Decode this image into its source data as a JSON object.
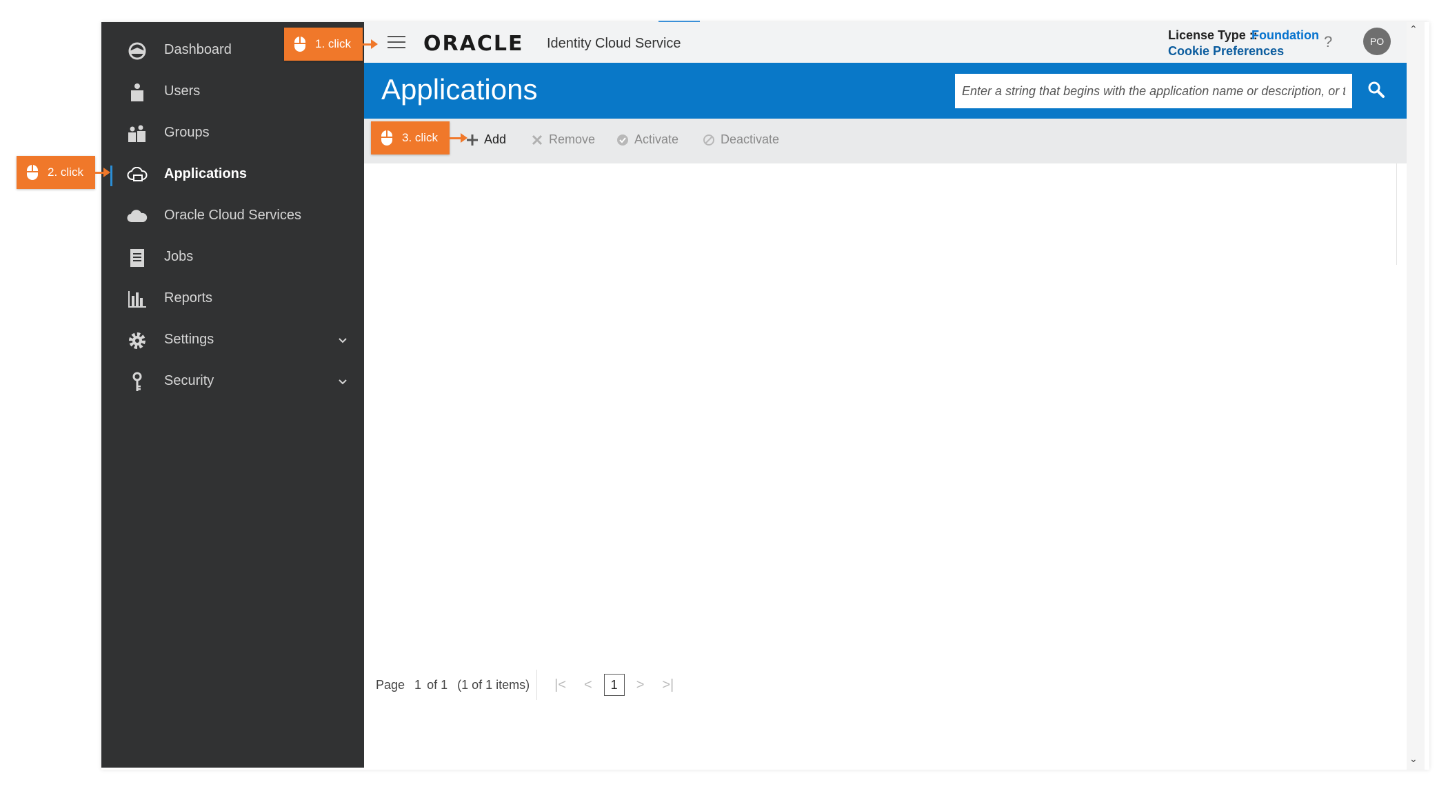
{
  "sidebar": {
    "items": [
      {
        "label": "Dashboard",
        "icon": "dashboard-icon"
      },
      {
        "label": "Users",
        "icon": "user-icon"
      },
      {
        "label": "Groups",
        "icon": "groups-icon"
      },
      {
        "label": "Applications",
        "icon": "applications-icon",
        "active": true
      },
      {
        "label": "Oracle Cloud Services",
        "icon": "cloud-icon"
      },
      {
        "label": "Jobs",
        "icon": "jobs-icon"
      },
      {
        "label": "Reports",
        "icon": "reports-icon"
      },
      {
        "label": "Settings",
        "icon": "gear-icon",
        "expandable": true
      },
      {
        "label": "Security",
        "icon": "key-icon",
        "expandable": true
      }
    ]
  },
  "topbar": {
    "logo": "ORACLE",
    "service_name": "Identity Cloud Service",
    "license_label": "License Type ::",
    "license_value": "Foundation",
    "cookie_link": "Cookie Preferences",
    "help": "?",
    "avatar_initials": "PO"
  },
  "header": {
    "title": "Applications",
    "search_placeholder": "Enter a string that begins with the application name or description, or t..."
  },
  "toolbar": {
    "add_label": "Add",
    "remove_label": "Remove",
    "activate_label": "Activate",
    "deactivate_label": "Deactivate"
  },
  "pager": {
    "page_label": "Page",
    "current_page": "1",
    "of_label": "of 1",
    "items_label": "(1 of 1 items)",
    "page_button": "1"
  },
  "callouts": [
    {
      "label": "1. click"
    },
    {
      "label": "2. click"
    },
    {
      "label": "3. click"
    }
  ],
  "colors": {
    "sidebar_bg": "#313233",
    "header_bg": "#0978c8",
    "callout": "#f0782a",
    "link": "#0572ce"
  }
}
